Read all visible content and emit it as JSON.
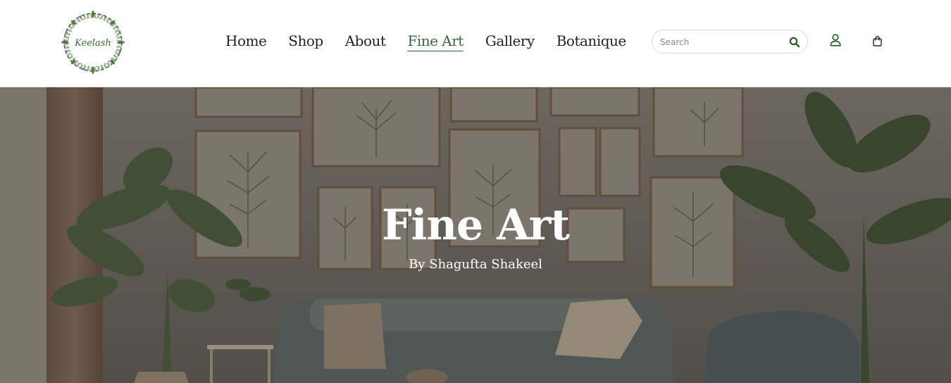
{
  "brand": {
    "logo_text": "Keelash",
    "logo_icon": "wreath-logo-icon"
  },
  "nav": {
    "items": [
      {
        "label": "Home"
      },
      {
        "label": "Shop"
      },
      {
        "label": "About"
      },
      {
        "label": "Fine Art"
      },
      {
        "label": "Gallery"
      },
      {
        "label": "Botanique"
      }
    ],
    "active": "Fine Art"
  },
  "search": {
    "placeholder": "Search",
    "value": "",
    "icon": "search-icon"
  },
  "actions": {
    "user_icon": "user-icon",
    "cart_icon": "shopping-bag-icon"
  },
  "hero": {
    "title": "Fine Art",
    "subtitle": "By Shagufta Shakeel"
  },
  "colors": {
    "accent": "#2f6b35",
    "nav_text": "#222222",
    "hero_text": "#ffffff"
  }
}
